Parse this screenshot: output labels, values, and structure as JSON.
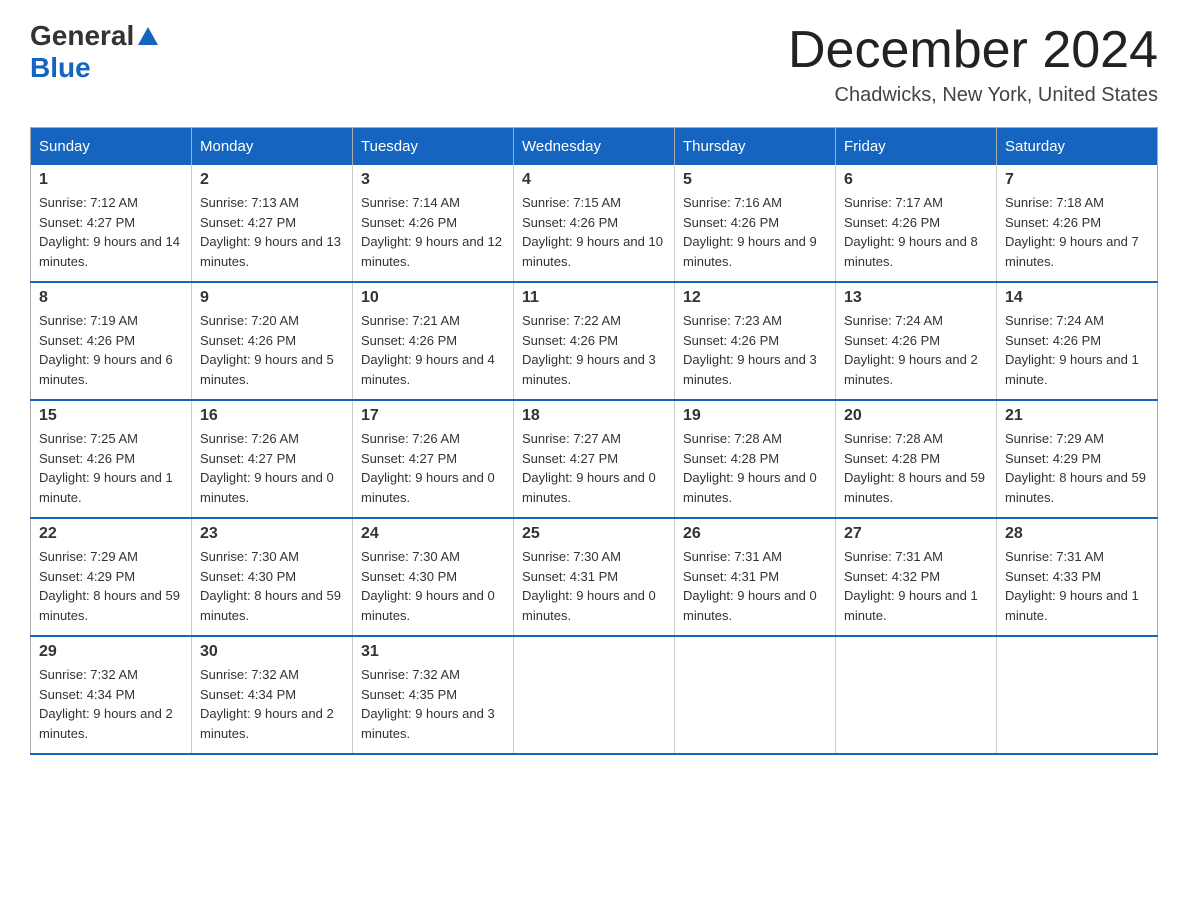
{
  "header": {
    "logo_general": "General",
    "logo_blue": "Blue",
    "title": "December 2024",
    "subtitle": "Chadwicks, New York, United States"
  },
  "days_of_week": [
    "Sunday",
    "Monday",
    "Tuesday",
    "Wednesday",
    "Thursday",
    "Friday",
    "Saturday"
  ],
  "weeks": [
    [
      {
        "day": "1",
        "sunrise": "7:12 AM",
        "sunset": "4:27 PM",
        "daylight": "9 hours and 14 minutes."
      },
      {
        "day": "2",
        "sunrise": "7:13 AM",
        "sunset": "4:27 PM",
        "daylight": "9 hours and 13 minutes."
      },
      {
        "day": "3",
        "sunrise": "7:14 AM",
        "sunset": "4:26 PM",
        "daylight": "9 hours and 12 minutes."
      },
      {
        "day": "4",
        "sunrise": "7:15 AM",
        "sunset": "4:26 PM",
        "daylight": "9 hours and 10 minutes."
      },
      {
        "day": "5",
        "sunrise": "7:16 AM",
        "sunset": "4:26 PM",
        "daylight": "9 hours and 9 minutes."
      },
      {
        "day": "6",
        "sunrise": "7:17 AM",
        "sunset": "4:26 PM",
        "daylight": "9 hours and 8 minutes."
      },
      {
        "day": "7",
        "sunrise": "7:18 AM",
        "sunset": "4:26 PM",
        "daylight": "9 hours and 7 minutes."
      }
    ],
    [
      {
        "day": "8",
        "sunrise": "7:19 AM",
        "sunset": "4:26 PM",
        "daylight": "9 hours and 6 minutes."
      },
      {
        "day": "9",
        "sunrise": "7:20 AM",
        "sunset": "4:26 PM",
        "daylight": "9 hours and 5 minutes."
      },
      {
        "day": "10",
        "sunrise": "7:21 AM",
        "sunset": "4:26 PM",
        "daylight": "9 hours and 4 minutes."
      },
      {
        "day": "11",
        "sunrise": "7:22 AM",
        "sunset": "4:26 PM",
        "daylight": "9 hours and 3 minutes."
      },
      {
        "day": "12",
        "sunrise": "7:23 AM",
        "sunset": "4:26 PM",
        "daylight": "9 hours and 3 minutes."
      },
      {
        "day": "13",
        "sunrise": "7:24 AM",
        "sunset": "4:26 PM",
        "daylight": "9 hours and 2 minutes."
      },
      {
        "day": "14",
        "sunrise": "7:24 AM",
        "sunset": "4:26 PM",
        "daylight": "9 hours and 1 minute."
      }
    ],
    [
      {
        "day": "15",
        "sunrise": "7:25 AM",
        "sunset": "4:26 PM",
        "daylight": "9 hours and 1 minute."
      },
      {
        "day": "16",
        "sunrise": "7:26 AM",
        "sunset": "4:27 PM",
        "daylight": "9 hours and 0 minutes."
      },
      {
        "day": "17",
        "sunrise": "7:26 AM",
        "sunset": "4:27 PM",
        "daylight": "9 hours and 0 minutes."
      },
      {
        "day": "18",
        "sunrise": "7:27 AM",
        "sunset": "4:27 PM",
        "daylight": "9 hours and 0 minutes."
      },
      {
        "day": "19",
        "sunrise": "7:28 AM",
        "sunset": "4:28 PM",
        "daylight": "9 hours and 0 minutes."
      },
      {
        "day": "20",
        "sunrise": "7:28 AM",
        "sunset": "4:28 PM",
        "daylight": "8 hours and 59 minutes."
      },
      {
        "day": "21",
        "sunrise": "7:29 AM",
        "sunset": "4:29 PM",
        "daylight": "8 hours and 59 minutes."
      }
    ],
    [
      {
        "day": "22",
        "sunrise": "7:29 AM",
        "sunset": "4:29 PM",
        "daylight": "8 hours and 59 minutes."
      },
      {
        "day": "23",
        "sunrise": "7:30 AM",
        "sunset": "4:30 PM",
        "daylight": "8 hours and 59 minutes."
      },
      {
        "day": "24",
        "sunrise": "7:30 AM",
        "sunset": "4:30 PM",
        "daylight": "9 hours and 0 minutes."
      },
      {
        "day": "25",
        "sunrise": "7:30 AM",
        "sunset": "4:31 PM",
        "daylight": "9 hours and 0 minutes."
      },
      {
        "day": "26",
        "sunrise": "7:31 AM",
        "sunset": "4:31 PM",
        "daylight": "9 hours and 0 minutes."
      },
      {
        "day": "27",
        "sunrise": "7:31 AM",
        "sunset": "4:32 PM",
        "daylight": "9 hours and 1 minute."
      },
      {
        "day": "28",
        "sunrise": "7:31 AM",
        "sunset": "4:33 PM",
        "daylight": "9 hours and 1 minute."
      }
    ],
    [
      {
        "day": "29",
        "sunrise": "7:32 AM",
        "sunset": "4:34 PM",
        "daylight": "9 hours and 2 minutes."
      },
      {
        "day": "30",
        "sunrise": "7:32 AM",
        "sunset": "4:34 PM",
        "daylight": "9 hours and 2 minutes."
      },
      {
        "day": "31",
        "sunrise": "7:32 AM",
        "sunset": "4:35 PM",
        "daylight": "9 hours and 3 minutes."
      },
      null,
      null,
      null,
      null
    ]
  ]
}
